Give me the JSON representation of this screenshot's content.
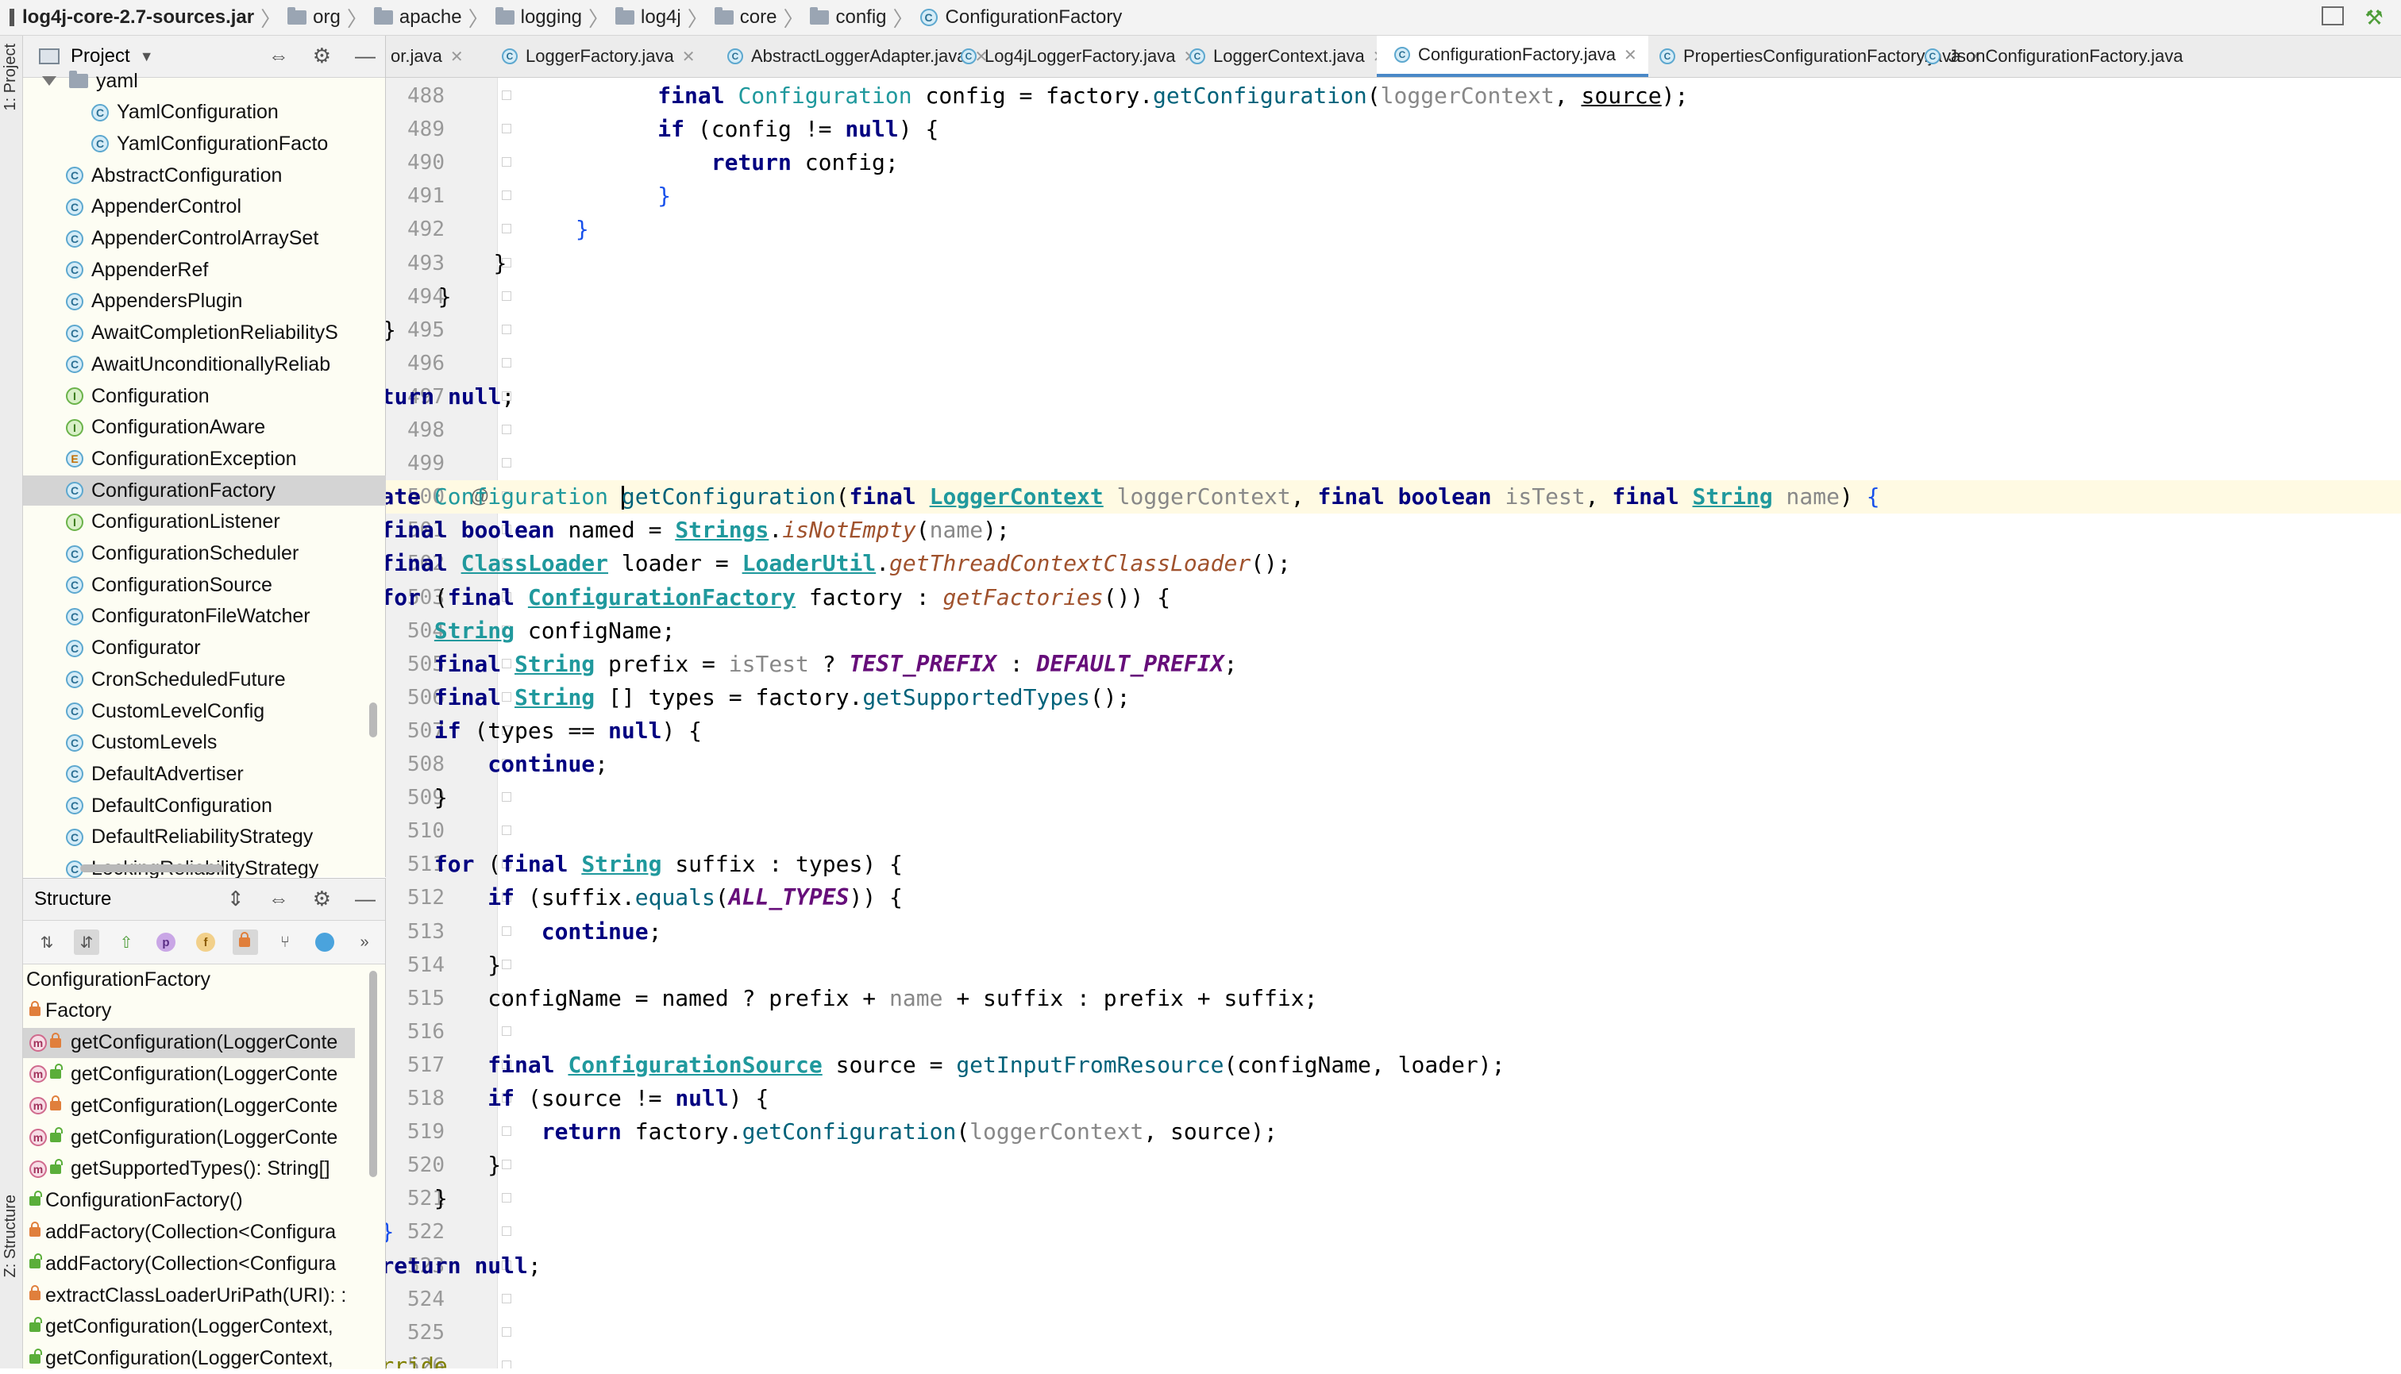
{
  "breadcrumbs": [
    "log4j-core-2.7-sources.jar",
    "org",
    "apache",
    "logging",
    "log4j",
    "core",
    "config",
    "ConfigurationFactory"
  ],
  "left_stripe": {
    "project_tab": "1: Project",
    "structure_tab": "Z: Structure"
  },
  "project_panel": {
    "title": "Project",
    "items": [
      {
        "label": "yaml",
        "kind": "folder"
      },
      {
        "label": "YamlConfiguration",
        "kind": "class"
      },
      {
        "label": "YamlConfigurationFacto",
        "kind": "class"
      },
      {
        "label": "AbstractConfiguration",
        "kind": "class"
      },
      {
        "label": "AppenderControl",
        "kind": "class"
      },
      {
        "label": "AppenderControlArraySet",
        "kind": "class"
      },
      {
        "label": "AppenderRef",
        "kind": "class"
      },
      {
        "label": "AppendersPlugin",
        "kind": "class"
      },
      {
        "label": "AwaitCompletionReliabilityS",
        "kind": "class"
      },
      {
        "label": "AwaitUnconditionallyReliab",
        "kind": "class"
      },
      {
        "label": "Configuration",
        "kind": "interface"
      },
      {
        "label": "ConfigurationAware",
        "kind": "interface"
      },
      {
        "label": "ConfigurationException",
        "kind": "exception"
      },
      {
        "label": "ConfigurationFactory",
        "kind": "class",
        "selected": true
      },
      {
        "label": "ConfigurationListener",
        "kind": "interface"
      },
      {
        "label": "ConfigurationScheduler",
        "kind": "class"
      },
      {
        "label": "ConfigurationSource",
        "kind": "class"
      },
      {
        "label": "ConfiguratonFileWatcher",
        "kind": "class"
      },
      {
        "label": "Configurator",
        "kind": "class"
      },
      {
        "label": "CronScheduledFuture",
        "kind": "class"
      },
      {
        "label": "CustomLevelConfig",
        "kind": "class"
      },
      {
        "label": "CustomLevels",
        "kind": "class"
      },
      {
        "label": "DefaultAdvertiser",
        "kind": "class"
      },
      {
        "label": "DefaultConfiguration",
        "kind": "class"
      },
      {
        "label": "DefaultReliabilityStrategy",
        "kind": "class"
      },
      {
        "label": "LockingReliabilityStrategy",
        "kind": "class"
      }
    ]
  },
  "structure_panel": {
    "title": "Structure",
    "items": [
      {
        "label": "ConfigurationFactory",
        "kind": "root"
      },
      {
        "label": "Factory",
        "kind": "field-private"
      },
      {
        "label": "getConfiguration(LoggerConte",
        "kind": "method-private",
        "selected": true
      },
      {
        "label": "getConfiguration(LoggerConte",
        "kind": "method-public"
      },
      {
        "label": "getConfiguration(LoggerConte",
        "kind": "method-private"
      },
      {
        "label": "getConfiguration(LoggerConte",
        "kind": "method-public"
      },
      {
        "label": "getSupportedTypes(): String[]",
        "kind": "method-public"
      },
      {
        "label": "ConfigurationFactory()",
        "kind": "ctor"
      },
      {
        "label": "addFactory(Collection<Configura",
        "kind": "member-private"
      },
      {
        "label": "addFactory(Collection<Configura",
        "kind": "member-public"
      },
      {
        "label": "extractClassLoaderUriPath(URI): :",
        "kind": "member-private"
      },
      {
        "label": "getConfiguration(LoggerContext,",
        "kind": "member-public"
      },
      {
        "label": "getConfiguration(LoggerContext,",
        "kind": "member-public"
      }
    ]
  },
  "tabs": [
    {
      "label": "or.java"
    },
    {
      "label": "LoggerFactory.java"
    },
    {
      "label": "AbstractLoggerAdapter.java"
    },
    {
      "label": "Log4jLoggerFactory.java"
    },
    {
      "label": "LoggerContext.java"
    },
    {
      "label": "ConfigurationFactory.java",
      "active": true
    },
    {
      "label": "PropertiesConfigurationFactory.java"
    },
    {
      "label": "JsonConfigurationFactory.java"
    }
  ],
  "editor": {
    "current_line": 500,
    "lines": [
      {
        "n": "488",
        "t": [
          [
            "",
            "            "
          ],
          [
            "kw",
            "final "
          ],
          [
            "type",
            "Configuration "
          ],
          [
            "",
            "config = factory."
          ],
          [
            "meth",
            "getConfiguration"
          ],
          [
            "",
            "("
          ],
          [
            "param",
            "loggerContext"
          ],
          [
            "",
            ", "
          ],
          [
            "u",
            "source"
          ],
          [
            "",
            ");"
          ]
        ]
      },
      {
        "n": "489",
        "t": [
          [
            "",
            "            "
          ],
          [
            "kw",
            "if "
          ],
          [
            "",
            "(config != "
          ],
          [
            "kw",
            "null"
          ],
          [
            "",
            ") {"
          ]
        ]
      },
      {
        "n": "490",
        "t": [
          [
            "",
            "                "
          ],
          [
            "kw",
            "return "
          ],
          [
            "",
            "config;"
          ]
        ]
      },
      {
        "n": "491",
        "t": [
          [
            "",
            "            "
          ],
          [
            "brace",
            "}"
          ]
        ]
      },
      {
        "n": "492",
        "t": [
          [
            "",
            "        "
          ],
          [
            "brace",
            "}"
          ]
        ]
      },
      {
        "n": "493",
        "t": [
          [
            "",
            "    "
          ],
          [
            "",
            "}"
          ]
        ]
      },
      {
        "n": "494",
        "t": [
          [
            "",
            "  "
          ],
          [
            "",
            "}"
          ]
        ]
      },
      {
        "n": "495",
        "t": [
          [
            "",
            "}"
          ]
        ]
      },
      {
        "n": "496",
        "t": [
          [
            "brace",
            "}"
          ]
        ]
      },
      {
        "n": "497",
        "t": [
          [
            "kw",
            "return null"
          ],
          [
            "",
            ";"
          ]
        ]
      },
      {
        "n": "498",
        "t": [
          [
            "brace",
            "}"
          ]
        ]
      },
      {
        "n": "499",
        "t": []
      },
      {
        "n": "500",
        "t": [
          [
            "kw",
            "private "
          ],
          [
            "type",
            "Configuration "
          ],
          [
            "caret",
            ""
          ],
          [
            "meth",
            "getConfiguration"
          ],
          [
            "",
            "("
          ],
          [
            "kw",
            "final "
          ],
          [
            "typeu",
            "LoggerContext"
          ],
          [
            "param",
            " loggerContext"
          ],
          [
            "",
            ", "
          ],
          [
            "kw",
            "final boolean "
          ],
          [
            "param",
            "isTest"
          ],
          [
            "",
            ", "
          ],
          [
            "kw",
            "final "
          ],
          [
            "typeu",
            "String"
          ],
          [
            "param",
            " name"
          ],
          [
            "",
            ") "
          ],
          [
            "brace",
            "{"
          ]
        ]
      },
      {
        "n": "501",
        "t": [
          [
            "",
            "    "
          ],
          [
            "kw",
            "final boolean "
          ],
          [
            "",
            "named = "
          ],
          [
            "typeu",
            "Strings"
          ],
          [
            "",
            "."
          ],
          [
            "static",
            "isNotEmpty"
          ],
          [
            "",
            "("
          ],
          [
            "param",
            "name"
          ],
          [
            "",
            ");"
          ]
        ]
      },
      {
        "n": "502",
        "t": [
          [
            "",
            "    "
          ],
          [
            "kw",
            "final "
          ],
          [
            "typeu",
            "ClassLoader"
          ],
          [
            "",
            " loader = "
          ],
          [
            "typeu",
            "LoaderUtil"
          ],
          [
            "",
            "."
          ],
          [
            "static",
            "getThreadContextClassLoader"
          ],
          [
            "",
            "();"
          ]
        ]
      },
      {
        "n": "503",
        "t": [
          [
            "",
            "    "
          ],
          [
            "kw",
            "for "
          ],
          [
            "",
            "("
          ],
          [
            "kw",
            "final "
          ],
          [
            "typeu",
            "ConfigurationFactory"
          ],
          [
            "",
            " factory : "
          ],
          [
            "static",
            "getFactories"
          ],
          [
            "",
            "()) {"
          ]
        ]
      },
      {
        "n": "504",
        "t": [
          [
            "",
            "        "
          ],
          [
            "typeu",
            "String"
          ],
          [
            "",
            " configName;"
          ]
        ]
      },
      {
        "n": "505",
        "t": [
          [
            "",
            "        "
          ],
          [
            "kw",
            "final "
          ],
          [
            "typeu",
            "String"
          ],
          [
            "",
            " prefix = "
          ],
          [
            "param",
            "isTest"
          ],
          [
            "",
            " ? "
          ],
          [
            "const",
            "TEST_PREFIX"
          ],
          [
            "",
            " : "
          ],
          [
            "const",
            "DEFAULT_PREFIX"
          ],
          [
            "",
            ";"
          ]
        ]
      },
      {
        "n": "506",
        "t": [
          [
            "",
            "        "
          ],
          [
            "kw",
            "final "
          ],
          [
            "typeu",
            "String"
          ],
          [
            "",
            " [] types = factory."
          ],
          [
            "meth",
            "getSupportedTypes"
          ],
          [
            "",
            "();"
          ]
        ]
      },
      {
        "n": "507",
        "t": [
          [
            "",
            "        "
          ],
          [
            "kw",
            "if "
          ],
          [
            "",
            "(types == "
          ],
          [
            "kw",
            "null"
          ],
          [
            "",
            ") {"
          ]
        ]
      },
      {
        "n": "508",
        "t": [
          [
            "",
            "            "
          ],
          [
            "kw",
            "continue"
          ],
          [
            "",
            ";"
          ]
        ]
      },
      {
        "n": "509",
        "t": [
          [
            "",
            "        "
          ],
          [
            "",
            "}"
          ]
        ]
      },
      {
        "n": "510",
        "t": []
      },
      {
        "n": "511",
        "t": [
          [
            "",
            "        "
          ],
          [
            "kw",
            "for "
          ],
          [
            "",
            "("
          ],
          [
            "kw",
            "final "
          ],
          [
            "typeu",
            "String"
          ],
          [
            "",
            " suffix : types) {"
          ]
        ]
      },
      {
        "n": "512",
        "t": [
          [
            "",
            "            "
          ],
          [
            "kw",
            "if "
          ],
          [
            "",
            "(suffix."
          ],
          [
            "meth",
            "equals"
          ],
          [
            "",
            "("
          ],
          [
            "const",
            "ALL_TYPES"
          ],
          [
            "",
            ")) {"
          ]
        ]
      },
      {
        "n": "513",
        "t": [
          [
            "",
            "                "
          ],
          [
            "kw",
            "continue"
          ],
          [
            "",
            ";"
          ]
        ]
      },
      {
        "n": "514",
        "t": [
          [
            "",
            "            "
          ],
          [
            "",
            "}"
          ]
        ]
      },
      {
        "n": "515",
        "t": [
          [
            "",
            "            "
          ],
          [
            "",
            "configName = named ? prefix + "
          ],
          [
            "param",
            "name"
          ],
          [
            "",
            " + suffix : prefix + suffix;"
          ]
        ]
      },
      {
        "n": "516",
        "t": []
      },
      {
        "n": "517",
        "t": [
          [
            "",
            "            "
          ],
          [
            "kw",
            "final "
          ],
          [
            "typeu",
            "ConfigurationSource"
          ],
          [
            "",
            " source = "
          ],
          [
            "meth",
            "getInputFromResource"
          ],
          [
            "",
            "(configName, loader);"
          ]
        ]
      },
      {
        "n": "518",
        "t": [
          [
            "",
            "            "
          ],
          [
            "kw",
            "if "
          ],
          [
            "",
            "(source != "
          ],
          [
            "kw",
            "null"
          ],
          [
            "",
            ") {"
          ]
        ]
      },
      {
        "n": "519",
        "t": [
          [
            "",
            "                "
          ],
          [
            "kw",
            "return "
          ],
          [
            "",
            "factory."
          ],
          [
            "meth",
            "getConfiguration"
          ],
          [
            "",
            "("
          ],
          [
            "param",
            "loggerContext"
          ],
          [
            "",
            ", source);"
          ]
        ]
      },
      {
        "n": "520",
        "t": [
          [
            "",
            "            "
          ],
          [
            "",
            "}"
          ]
        ]
      },
      {
        "n": "521",
        "t": [
          [
            "",
            "        "
          ],
          [
            "",
            "}"
          ]
        ]
      },
      {
        "n": "522",
        "t": [
          [
            "",
            "    "
          ],
          [
            "brace",
            "}"
          ]
        ]
      },
      {
        "n": "523",
        "t": [
          [
            "",
            "    "
          ],
          [
            "kw",
            "return null"
          ],
          [
            "",
            ";"
          ]
        ]
      },
      {
        "n": "524",
        "t": [
          [
            "brace",
            "}"
          ]
        ]
      },
      {
        "n": "525",
        "t": []
      },
      {
        "n": "526",
        "t": [
          [
            "anno",
            "@Override"
          ]
        ]
      }
    ]
  }
}
